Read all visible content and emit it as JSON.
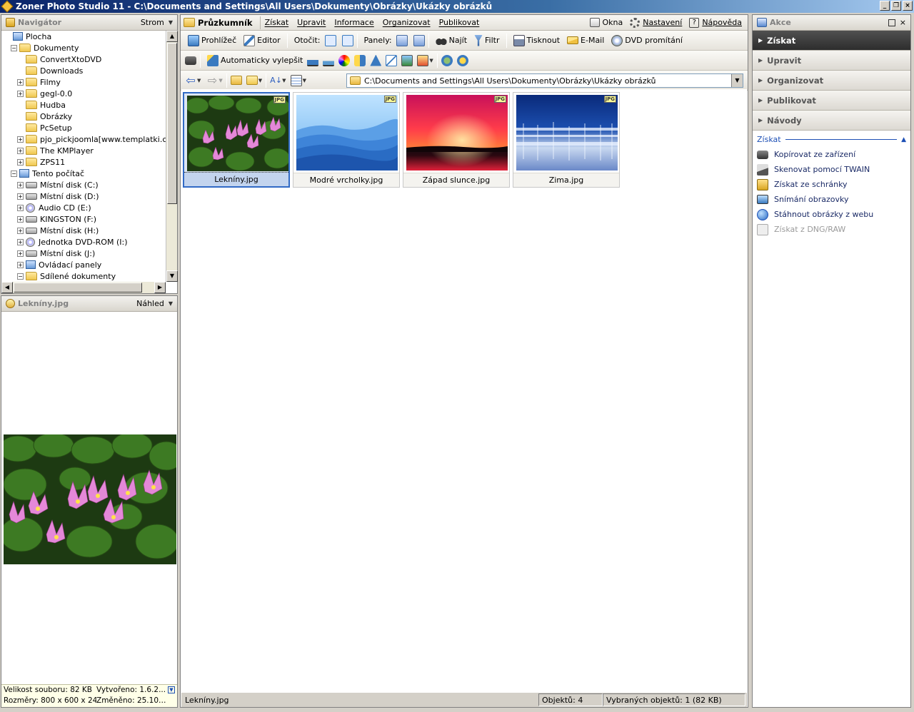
{
  "window": {
    "title": "Zoner Photo Studio 11 - C:\\Documents and Settings\\All Users\\Dokumenty\\Obrázky\\Ukázky obrázků",
    "buttons": [
      "_",
      "❐",
      "×"
    ]
  },
  "navigator": {
    "title": "Navigátor",
    "mode": "Strom",
    "tree": [
      {
        "label": "Plocha",
        "indent": 0,
        "icon": "desktop",
        "exp": ""
      },
      {
        "label": "Dokumenty",
        "indent": 1,
        "icon": "folder",
        "exp": "−"
      },
      {
        "label": "ConvertXtoDVD",
        "indent": 2,
        "icon": "folder",
        "exp": ""
      },
      {
        "label": "Downloads",
        "indent": 2,
        "icon": "folder",
        "exp": ""
      },
      {
        "label": "Filmy",
        "indent": 2,
        "icon": "folder",
        "exp": "+"
      },
      {
        "label": "gegl-0.0",
        "indent": 2,
        "icon": "folder",
        "exp": "+"
      },
      {
        "label": "Hudba",
        "indent": 2,
        "icon": "folder",
        "exp": ""
      },
      {
        "label": "Obrázky",
        "indent": 2,
        "icon": "folder",
        "exp": ""
      },
      {
        "label": "PcSetup",
        "indent": 2,
        "icon": "folder",
        "exp": ""
      },
      {
        "label": "pjo_pickjoomla[www.templatki.com",
        "indent": 2,
        "icon": "folder",
        "exp": "+"
      },
      {
        "label": "The KMPlayer",
        "indent": 2,
        "icon": "folder",
        "exp": "+"
      },
      {
        "label": "ZPS11",
        "indent": 2,
        "icon": "folder",
        "exp": "+"
      },
      {
        "label": "Tento počítač",
        "indent": 1,
        "icon": "pc",
        "exp": "−"
      },
      {
        "label": "Místní disk (C:)",
        "indent": 2,
        "icon": "drive",
        "exp": "+"
      },
      {
        "label": "Místní disk (D:)",
        "indent": 2,
        "icon": "drive",
        "exp": "+"
      },
      {
        "label": "Audio CD (E:)",
        "indent": 2,
        "icon": "cd",
        "exp": "+"
      },
      {
        "label": "KINGSTON (F:)",
        "indent": 2,
        "icon": "drive",
        "exp": "+"
      },
      {
        "label": "Místní disk (H:)",
        "indent": 2,
        "icon": "drive",
        "exp": "+"
      },
      {
        "label": "Jednotka DVD-ROM (I:)",
        "indent": 2,
        "icon": "cd",
        "exp": "+"
      },
      {
        "label": "Místní disk (J:)",
        "indent": 2,
        "icon": "drive",
        "exp": "+"
      },
      {
        "label": "Ovládací panely",
        "indent": 2,
        "icon": "pc",
        "exp": "+"
      },
      {
        "label": "Sdílené dokumenty",
        "indent": 2,
        "icon": "folder",
        "exp": "−"
      }
    ]
  },
  "preview": {
    "title": "Lekníny.jpg",
    "mode": "Náhled",
    "info": {
      "size": "Velikost souboru: 82 KB",
      "created": "Vytvořeno: 1.6.2...",
      "dims": "Rozměry: 800 x 600 x 24",
      "modified": "Změněno: 25.10...."
    }
  },
  "menu": {
    "main": "Průzkumník",
    "items": [
      "Získat",
      "Upravit",
      "Informace",
      "Organizovat",
      "Publikovat"
    ],
    "right": [
      "Okna",
      "Nastavení",
      "Nápověda"
    ]
  },
  "toolbar1": {
    "viewer": "Prohlížeč",
    "editor": "Editor",
    "rotate": "Otočit:",
    "panels": "Panely:",
    "find": "Najít",
    "filter": "Filtr",
    "print": "Tisknout",
    "email": "E-Mail",
    "dvd": "DVD promítání"
  },
  "toolbar2": {
    "auto": "Automaticky vylepšit"
  },
  "address": {
    "path": "C:\\Documents and Settings\\All Users\\Dokumenty\\Obrázky\\Ukázky obrázků"
  },
  "thumbnails": [
    {
      "name": "Lekníny.jpg",
      "badge": "JPG",
      "selected": true
    },
    {
      "name": "Modré vrcholky.jpg",
      "badge": "JPG",
      "selected": false
    },
    {
      "name": "Západ slunce.jpg",
      "badge": "JPG",
      "selected": false
    },
    {
      "name": "Zima.jpg",
      "badge": "JPG",
      "selected": false
    }
  ],
  "status": {
    "file": "Lekníny.jpg",
    "objects": "Objektů: 4",
    "selected": "Vybraných objektů: 1 (82 KB)"
  },
  "actions": {
    "title": "Akce",
    "categories": [
      "Získat",
      "Upravit",
      "Organizovat",
      "Publikovat",
      "Návody"
    ],
    "section_title": "Získat",
    "items": [
      {
        "label": "Kopírovat ze zařízení",
        "icon": "camera-icon",
        "enabled": true
      },
      {
        "label": "Skenovat pomocí TWAIN",
        "icon": "scanner-icon",
        "enabled": true
      },
      {
        "label": "Získat ze schránky",
        "icon": "clipboard-icon",
        "enabled": true
      },
      {
        "label": "Snímání obrazovky",
        "icon": "monitor-icon",
        "enabled": true
      },
      {
        "label": "Stáhnout obrázky z webu",
        "icon": "globe-icon",
        "enabled": true
      },
      {
        "label": "Získat z DNG/RAW",
        "icon": "raw-file-icon",
        "enabled": false
      }
    ]
  },
  "colors": {
    "titlebar": "#0a246a",
    "selection": "#316ac5",
    "active_category": "#2d2d2d",
    "link": "#1c4fb5"
  }
}
